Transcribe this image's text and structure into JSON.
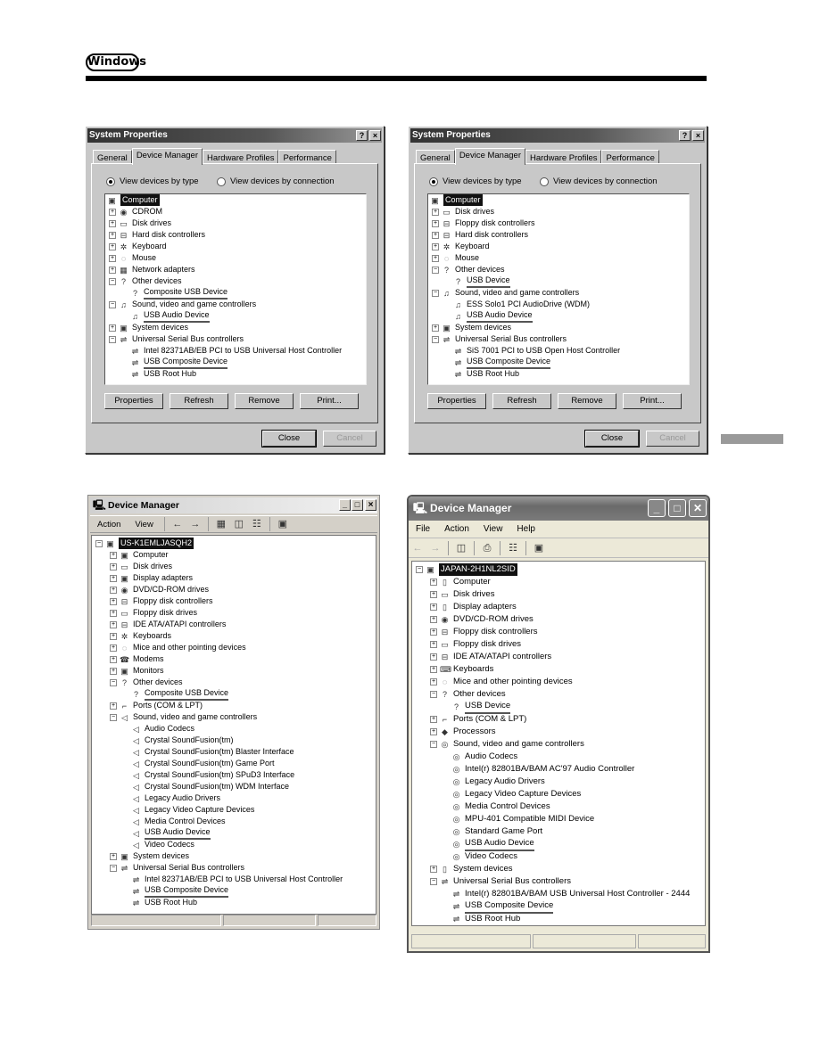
{
  "header": {
    "badge": "Windows"
  },
  "win98_a": {
    "title": "System Properties",
    "help_btn": "?",
    "close_btn": "×",
    "tabs": [
      "General",
      "Device Manager",
      "Hardware Profiles",
      "Performance"
    ],
    "radio_type": "View devices by type",
    "radio_conn": "View devices by connection",
    "tree": [
      {
        "label": "Computer",
        "level": 0,
        "exp": "",
        "icon": "computer-icon",
        "glyph": "▣",
        "sel": true
      },
      {
        "label": "CDROM",
        "level": 1,
        "exp": "+",
        "icon": "cdrom-icon",
        "glyph": "◉"
      },
      {
        "label": "Disk drives",
        "level": 1,
        "exp": "+",
        "icon": "disk-icon",
        "glyph": "▭"
      },
      {
        "label": "Hard disk controllers",
        "level": 1,
        "exp": "+",
        "icon": "controller-icon",
        "glyph": "⊟"
      },
      {
        "label": "Keyboard",
        "level": 1,
        "exp": "+",
        "icon": "keyboard-icon",
        "glyph": "✲"
      },
      {
        "label": "Mouse",
        "level": 1,
        "exp": "+",
        "icon": "mouse-icon",
        "glyph": "◌"
      },
      {
        "label": "Network adapters",
        "level": 1,
        "exp": "+",
        "icon": "network-icon",
        "glyph": "▦"
      },
      {
        "label": "Other devices",
        "level": 1,
        "exp": "−",
        "icon": "question-icon",
        "glyph": "?"
      },
      {
        "label": "Composite USB Device",
        "level": 2,
        "exp": "",
        "icon": "question-icon",
        "glyph": "?",
        "ul": true
      },
      {
        "label": "Sound, video and game controllers",
        "level": 1,
        "exp": "−",
        "icon": "sound-icon",
        "glyph": "♫"
      },
      {
        "label": "USB Audio Device",
        "level": 2,
        "exp": "",
        "icon": "sound-icon",
        "glyph": "♫",
        "ul": true
      },
      {
        "label": "System devices",
        "level": 1,
        "exp": "+",
        "icon": "system-icon",
        "glyph": "▣"
      },
      {
        "label": "Universal Serial Bus controllers",
        "level": 1,
        "exp": "−",
        "icon": "usb-icon",
        "glyph": "⇌"
      },
      {
        "label": "Intel 82371AB/EB PCI to USB Universal Host Controller",
        "level": 2,
        "exp": "",
        "icon": "usb-icon",
        "glyph": "⇌"
      },
      {
        "label": "USB Composite Device",
        "level": 2,
        "exp": "",
        "icon": "usb-icon",
        "glyph": "⇌",
        "ul": true
      },
      {
        "label": "USB Root Hub",
        "level": 2,
        "exp": "",
        "icon": "usb-icon",
        "glyph": "⇌"
      }
    ],
    "buttons": [
      "Properties",
      "Refresh",
      "Remove",
      "Print..."
    ],
    "close": "Close",
    "cancel": "Cancel"
  },
  "win98_b": {
    "title": "System Properties",
    "help_btn": "?",
    "close_btn": "×",
    "tabs": [
      "General",
      "Device Manager",
      "Hardware Profiles",
      "Performance"
    ],
    "radio_type": "View devices by type",
    "radio_conn": "View devices by connection",
    "tree": [
      {
        "label": "Computer",
        "level": 0,
        "exp": "",
        "icon": "computer-icon",
        "glyph": "▣",
        "sel": true
      },
      {
        "label": "Disk drives",
        "level": 1,
        "exp": "+",
        "icon": "disk-icon",
        "glyph": "▭"
      },
      {
        "label": "Floppy disk controllers",
        "level": 1,
        "exp": "+",
        "icon": "controller-icon",
        "glyph": "⊟"
      },
      {
        "label": "Hard disk controllers",
        "level": 1,
        "exp": "+",
        "icon": "controller-icon",
        "glyph": "⊟"
      },
      {
        "label": "Keyboard",
        "level": 1,
        "exp": "+",
        "icon": "keyboard-icon",
        "glyph": "✲"
      },
      {
        "label": "Mouse",
        "level": 1,
        "exp": "+",
        "icon": "mouse-icon",
        "glyph": "◌"
      },
      {
        "label": "Other devices",
        "level": 1,
        "exp": "−",
        "icon": "question-icon",
        "glyph": "?"
      },
      {
        "label": "USB Device",
        "level": 2,
        "exp": "",
        "icon": "question-icon",
        "glyph": "?",
        "ul": true
      },
      {
        "label": "Sound, video and game controllers",
        "level": 1,
        "exp": "−",
        "icon": "sound-icon",
        "glyph": "♫"
      },
      {
        "label": "ESS Solo1 PCI AudioDrive (WDM)",
        "level": 2,
        "exp": "",
        "icon": "sound-icon",
        "glyph": "♫"
      },
      {
        "label": "USB Audio Device",
        "level": 2,
        "exp": "",
        "icon": "sound-icon",
        "glyph": "♫",
        "ul": true
      },
      {
        "label": "System devices",
        "level": 1,
        "exp": "+",
        "icon": "system-icon",
        "glyph": "▣"
      },
      {
        "label": "Universal Serial Bus controllers",
        "level": 1,
        "exp": "−",
        "icon": "usb-icon",
        "glyph": "⇌"
      },
      {
        "label": "SiS 7001 PCI to USB Open Host Controller",
        "level": 2,
        "exp": "",
        "icon": "usb-icon",
        "glyph": "⇌"
      },
      {
        "label": "USB Composite Device",
        "level": 2,
        "exp": "",
        "icon": "usb-icon",
        "glyph": "⇌",
        "ul": true
      },
      {
        "label": "USB Root Hub",
        "level": 2,
        "exp": "",
        "icon": "usb-icon",
        "glyph": "⇌"
      }
    ],
    "buttons": [
      "Properties",
      "Refresh",
      "Remove",
      "Print..."
    ],
    "close": "Close",
    "cancel": "Cancel"
  },
  "win2k": {
    "title": "Device Manager",
    "menu": [
      "Action",
      "View"
    ],
    "tree": [
      {
        "label": "US-K1EMLJASQH2",
        "level": 0,
        "exp": "−",
        "icon": "computer-icon",
        "glyph": "▣",
        "sel": true
      },
      {
        "label": "Computer",
        "level": 1,
        "exp": "+",
        "icon": "computer-icon",
        "glyph": "▣"
      },
      {
        "label": "Disk drives",
        "level": 1,
        "exp": "+",
        "icon": "disk-icon",
        "glyph": "▭"
      },
      {
        "label": "Display adapters",
        "level": 1,
        "exp": "+",
        "icon": "display-icon",
        "glyph": "▣"
      },
      {
        "label": "DVD/CD-ROM drives",
        "level": 1,
        "exp": "+",
        "icon": "cdrom-icon",
        "glyph": "◉"
      },
      {
        "label": "Floppy disk controllers",
        "level": 1,
        "exp": "+",
        "icon": "controller-icon",
        "glyph": "⊟"
      },
      {
        "label": "Floppy disk drives",
        "level": 1,
        "exp": "+",
        "icon": "floppy-icon",
        "glyph": "▭"
      },
      {
        "label": "IDE ATA/ATAPI controllers",
        "level": 1,
        "exp": "+",
        "icon": "controller-icon",
        "glyph": "⊟"
      },
      {
        "label": "Keyboards",
        "level": 1,
        "exp": "+",
        "icon": "keyboard-icon",
        "glyph": "✲"
      },
      {
        "label": "Mice and other pointing devices",
        "level": 1,
        "exp": "+",
        "icon": "mouse-icon",
        "glyph": "◌"
      },
      {
        "label": "Modems",
        "level": 1,
        "exp": "+",
        "icon": "modem-icon",
        "glyph": "☎"
      },
      {
        "label": "Monitors",
        "level": 1,
        "exp": "+",
        "icon": "monitor-icon",
        "glyph": "▣"
      },
      {
        "label": "Other devices",
        "level": 1,
        "exp": "−",
        "icon": "question-icon",
        "glyph": "?"
      },
      {
        "label": "Composite USB Device",
        "level": 2,
        "exp": "",
        "icon": "question-icon",
        "glyph": "?",
        "ul": true
      },
      {
        "label": "Ports (COM & LPT)",
        "level": 1,
        "exp": "+",
        "icon": "port-icon",
        "glyph": "⌐"
      },
      {
        "label": "Sound, video and game controllers",
        "level": 1,
        "exp": "−",
        "icon": "sound-icon",
        "glyph": "◁"
      },
      {
        "label": "Audio Codecs",
        "level": 2,
        "exp": "",
        "icon": "sound-icon",
        "glyph": "◁"
      },
      {
        "label": "Crystal SoundFusion(tm)",
        "level": 2,
        "exp": "",
        "icon": "sound-icon",
        "glyph": "◁"
      },
      {
        "label": "Crystal SoundFusion(tm) Blaster Interface",
        "level": 2,
        "exp": "",
        "icon": "sound-icon",
        "glyph": "◁"
      },
      {
        "label": "Crystal SoundFusion(tm) Game Port",
        "level": 2,
        "exp": "",
        "icon": "sound-icon",
        "glyph": "◁"
      },
      {
        "label": "Crystal SoundFusion(tm) SPuD3 Interface",
        "level": 2,
        "exp": "",
        "icon": "sound-icon",
        "glyph": "◁"
      },
      {
        "label": "Crystal SoundFusion(tm) WDM Interface",
        "level": 2,
        "exp": "",
        "icon": "sound-icon",
        "glyph": "◁"
      },
      {
        "label": "Legacy Audio Drivers",
        "level": 2,
        "exp": "",
        "icon": "sound-icon",
        "glyph": "◁"
      },
      {
        "label": "Legacy Video Capture Devices",
        "level": 2,
        "exp": "",
        "icon": "sound-icon",
        "glyph": "◁"
      },
      {
        "label": "Media Control Devices",
        "level": 2,
        "exp": "",
        "icon": "sound-icon",
        "glyph": "◁"
      },
      {
        "label": "USB Audio Device",
        "level": 2,
        "exp": "",
        "icon": "sound-icon",
        "glyph": "◁",
        "ul": true
      },
      {
        "label": "Video Codecs",
        "level": 2,
        "exp": "",
        "icon": "sound-icon",
        "glyph": "◁"
      },
      {
        "label": "System devices",
        "level": 1,
        "exp": "+",
        "icon": "system-icon",
        "glyph": "▣"
      },
      {
        "label": "Universal Serial Bus controllers",
        "level": 1,
        "exp": "−",
        "icon": "usb-icon",
        "glyph": "⇌"
      },
      {
        "label": "Intel 82371AB/EB PCI to USB Universal Host Controller",
        "level": 2,
        "exp": "",
        "icon": "usb-icon",
        "glyph": "⇌"
      },
      {
        "label": "USB Composite Device",
        "level": 2,
        "exp": "",
        "icon": "usb-icon",
        "glyph": "⇌",
        "ul": true
      },
      {
        "label": "USB Root Hub",
        "level": 2,
        "exp": "",
        "icon": "usb-icon",
        "glyph": "⇌"
      }
    ]
  },
  "winxp": {
    "title": "Device Manager",
    "menu": [
      "File",
      "Action",
      "View",
      "Help"
    ],
    "tree": [
      {
        "label": "JAPAN-2H1NL2SID",
        "level": 0,
        "exp": "−",
        "icon": "computer-icon",
        "glyph": "▣",
        "sel": true
      },
      {
        "label": "Computer",
        "level": 1,
        "exp": "+",
        "icon": "computer-icon",
        "glyph": "▯"
      },
      {
        "label": "Disk drives",
        "level": 1,
        "exp": "+",
        "icon": "disk-icon",
        "glyph": "▭"
      },
      {
        "label": "Display adapters",
        "level": 1,
        "exp": "+",
        "icon": "display-icon",
        "glyph": "▯"
      },
      {
        "label": "DVD/CD-ROM drives",
        "level": 1,
        "exp": "+",
        "icon": "cdrom-icon",
        "glyph": "◉"
      },
      {
        "label": "Floppy disk controllers",
        "level": 1,
        "exp": "+",
        "icon": "controller-icon",
        "glyph": "⊟"
      },
      {
        "label": "Floppy disk drives",
        "level": 1,
        "exp": "+",
        "icon": "floppy-icon",
        "glyph": "▭"
      },
      {
        "label": "IDE ATA/ATAPI controllers",
        "level": 1,
        "exp": "+",
        "icon": "controller-icon",
        "glyph": "⊟"
      },
      {
        "label": "Keyboards",
        "level": 1,
        "exp": "+",
        "icon": "keyboard-icon",
        "glyph": "⌨"
      },
      {
        "label": "Mice and other pointing devices",
        "level": 1,
        "exp": "+",
        "icon": "mouse-icon",
        "glyph": "◌"
      },
      {
        "label": "Other devices",
        "level": 1,
        "exp": "−",
        "icon": "question-icon",
        "glyph": "?"
      },
      {
        "label": "USB Device",
        "level": 2,
        "exp": "",
        "icon": "question-icon",
        "glyph": "?",
        "ul": true
      },
      {
        "label": "Ports (COM & LPT)",
        "level": 1,
        "exp": "+",
        "icon": "port-icon",
        "glyph": "⌐"
      },
      {
        "label": "Processors",
        "level": 1,
        "exp": "+",
        "icon": "processor-icon",
        "glyph": "◆"
      },
      {
        "label": "Sound, video and game controllers",
        "level": 1,
        "exp": "−",
        "icon": "sound-icon",
        "glyph": "◎"
      },
      {
        "label": "Audio Codecs",
        "level": 2,
        "exp": "",
        "icon": "sound-icon",
        "glyph": "◎"
      },
      {
        "label": "Intel(r) 82801BA/BAM AC'97 Audio Controller",
        "level": 2,
        "exp": "",
        "icon": "sound-icon",
        "glyph": "◎"
      },
      {
        "label": "Legacy Audio Drivers",
        "level": 2,
        "exp": "",
        "icon": "sound-icon",
        "glyph": "◎"
      },
      {
        "label": "Legacy Video Capture Devices",
        "level": 2,
        "exp": "",
        "icon": "sound-icon",
        "glyph": "◎"
      },
      {
        "label": "Media Control Devices",
        "level": 2,
        "exp": "",
        "icon": "sound-icon",
        "glyph": "◎"
      },
      {
        "label": "MPU-401 Compatible MIDI Device",
        "level": 2,
        "exp": "",
        "icon": "sound-icon",
        "glyph": "◎"
      },
      {
        "label": "Standard Game Port",
        "level": 2,
        "exp": "",
        "icon": "sound-icon",
        "glyph": "◎"
      },
      {
        "label": "USB Audio Device",
        "level": 2,
        "exp": "",
        "icon": "sound-icon",
        "glyph": "◎",
        "ul": true
      },
      {
        "label": "Video Codecs",
        "level": 2,
        "exp": "",
        "icon": "sound-icon",
        "glyph": "◎"
      },
      {
        "label": "System devices",
        "level": 1,
        "exp": "+",
        "icon": "system-icon",
        "glyph": "▯"
      },
      {
        "label": "Universal Serial Bus controllers",
        "level": 1,
        "exp": "−",
        "icon": "usb-icon",
        "glyph": "⇌"
      },
      {
        "label": "Intel(r) 82801BA/BAM USB Universal Host Controller - 2444",
        "level": 2,
        "exp": "",
        "icon": "usb-icon",
        "glyph": "⇌"
      },
      {
        "label": "USB Composite Device",
        "level": 2,
        "exp": "",
        "icon": "usb-icon",
        "glyph": "⇌",
        "ul": true
      },
      {
        "label": "USB Root Hub",
        "level": 2,
        "exp": "",
        "icon": "usb-icon",
        "glyph": "⇌"
      }
    ]
  }
}
